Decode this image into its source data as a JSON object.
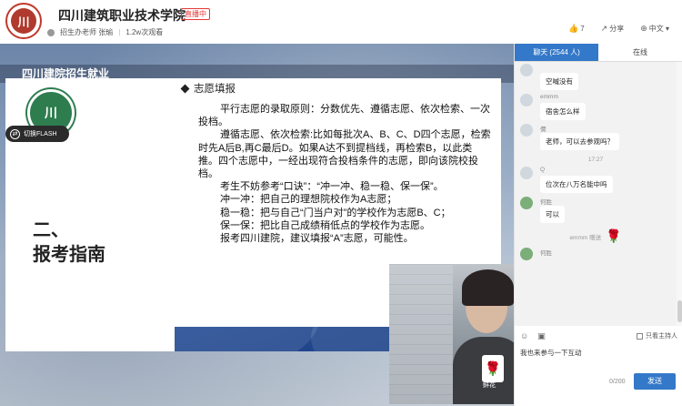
{
  "header": {
    "logo_text": "川",
    "title": "四川建筑职业技术学院",
    "live_badge": "直播中",
    "host": "招生办老师 张瑜",
    "views": "1.2w次观看",
    "likes": "7",
    "share": "分享",
    "language": "中文"
  },
  "stage": {
    "label": "四川建院招生就业",
    "flash_button": "切换FLASH",
    "school_logo_text": "川",
    "section_no": "二、",
    "section_title": "报考指南",
    "card_heading": "志愿填报",
    "paragraphs": [
      "平行志愿的录取原则：分数优先、遵循志愿、依次检索、一次投档。",
      "遵循志愿、依次检索:比如每批次A、B、C、D四个志愿，检索时先A后B,再C最后D。如果A达不到提档线，再检索B，以此类推。四个志愿中，一经出现符合投档条件的志愿，即向该院校投档。",
      "考生不妨参考“口诀”：“冲一冲、稳一稳、保一保”。",
      "冲一冲：把自己的理想院校作为A志愿；",
      "稳一稳：把与自己“门当户对”的学校作为志愿B、C；",
      "保一保：把比自己成绩稍低点的学校作为志愿。",
      "报考四川建院，建议填报“A”志愿，可能性。"
    ],
    "gift_label": "鲜花"
  },
  "chat": {
    "tabs": [
      {
        "label": "聊天 (2544 人)",
        "active": true
      },
      {
        "label": "在线",
        "active": false
      }
    ],
    "messages": [
      {
        "type": "msg",
        "user": "",
        "text": "空喊没有",
        "avatar": "gray"
      },
      {
        "type": "msg",
        "user": "emmm",
        "text": "宿舍怎么样",
        "avatar": "gray"
      },
      {
        "type": "msg",
        "user": "僴",
        "text": "老师，可以去参观吗？",
        "avatar": "gray"
      },
      {
        "type": "time",
        "text": "17:27"
      },
      {
        "type": "msg",
        "user": "Q",
        "text": "位次在八万名能中吗",
        "avatar": "gray"
      },
      {
        "type": "msg",
        "user": "何胜",
        "text": "可以",
        "avatar": "green"
      },
      {
        "type": "gift",
        "text": "emmm 赠送",
        "gift": "鲜花"
      },
      {
        "type": "msg",
        "user": "何胜",
        "text": "",
        "avatar": "green"
      }
    ],
    "host_only": "只看主持人",
    "input_value": "我也来参与一下互动",
    "counter": "0/200",
    "send": "发送"
  }
}
